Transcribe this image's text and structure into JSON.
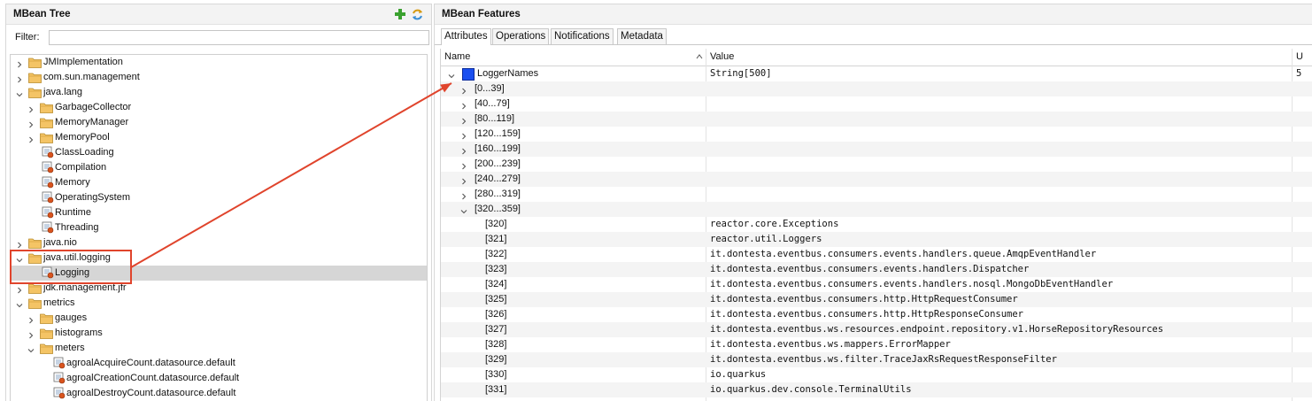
{
  "left_panel": {
    "title": "MBean Tree",
    "filter_label": "Filter:",
    "filter_value": "",
    "tree": [
      {
        "label": "JMImplementation",
        "level": 0,
        "type": "folder",
        "expanded": false
      },
      {
        "label": "com.sun.management",
        "level": 0,
        "type": "folder",
        "expanded": false
      },
      {
        "label": "java.lang",
        "level": 0,
        "type": "folder",
        "expanded": true
      },
      {
        "label": "GarbageCollector",
        "level": 1,
        "type": "folder",
        "expanded": false
      },
      {
        "label": "MemoryManager",
        "level": 1,
        "type": "folder",
        "expanded": false
      },
      {
        "label": "MemoryPool",
        "level": 1,
        "type": "folder",
        "expanded": false
      },
      {
        "label": "ClassLoading",
        "level": 1,
        "type": "bean"
      },
      {
        "label": "Compilation",
        "level": 1,
        "type": "bean"
      },
      {
        "label": "Memory",
        "level": 1,
        "type": "bean"
      },
      {
        "label": "OperatingSystem",
        "level": 1,
        "type": "bean"
      },
      {
        "label": "Runtime",
        "level": 1,
        "type": "bean"
      },
      {
        "label": "Threading",
        "level": 1,
        "type": "bean"
      },
      {
        "label": "java.nio",
        "level": 0,
        "type": "folder",
        "expanded": false
      },
      {
        "label": "java.util.logging",
        "level": 0,
        "type": "folder",
        "expanded": true
      },
      {
        "label": "Logging",
        "level": 1,
        "type": "bean",
        "selected": true
      },
      {
        "label": "jdk.management.jfr",
        "level": 0,
        "type": "folder",
        "expanded": false
      },
      {
        "label": "metrics",
        "level": 0,
        "type": "folder",
        "expanded": true
      },
      {
        "label": "gauges",
        "level": 1,
        "type": "folder",
        "expanded": false
      },
      {
        "label": "histograms",
        "level": 1,
        "type": "folder",
        "expanded": false
      },
      {
        "label": "meters",
        "level": 1,
        "type": "folder",
        "expanded": true
      },
      {
        "label": "agroalAcquireCount.datasource.default",
        "level": 2,
        "type": "bean"
      },
      {
        "label": "agroalCreationCount.datasource.default",
        "level": 2,
        "type": "bean"
      },
      {
        "label": "agroalDestroyCount.datasource.default",
        "level": 2,
        "type": "bean"
      }
    ]
  },
  "right_panel": {
    "title": "MBean Features",
    "tabs": [
      {
        "label": "Attributes",
        "active": true
      },
      {
        "label": "Operations",
        "active": false
      },
      {
        "label": "Notifications",
        "active": false
      },
      {
        "label": "Metadata",
        "active": false
      }
    ],
    "columns": {
      "name": "Name",
      "value": "Value",
      "third": "U"
    },
    "sort_indicator": "^",
    "rows": [
      {
        "name": "LoggerNames",
        "value": "String[500]",
        "third": "5",
        "level": 0,
        "chevron": "down",
        "square": true
      },
      {
        "name": "[0...39]",
        "value": "",
        "level": 1,
        "chevron": "right"
      },
      {
        "name": "[40...79]",
        "value": "",
        "level": 1,
        "chevron": "right"
      },
      {
        "name": "[80...119]",
        "value": "",
        "level": 1,
        "chevron": "right"
      },
      {
        "name": "[120...159]",
        "value": "",
        "level": 1,
        "chevron": "right"
      },
      {
        "name": "[160...199]",
        "value": "",
        "level": 1,
        "chevron": "right"
      },
      {
        "name": "[200...239]",
        "value": "",
        "level": 1,
        "chevron": "right"
      },
      {
        "name": "[240...279]",
        "value": "",
        "level": 1,
        "chevron": "right"
      },
      {
        "name": "[280...319]",
        "value": "",
        "level": 1,
        "chevron": "right"
      },
      {
        "name": "[320...359]",
        "value": "",
        "level": 1,
        "chevron": "down"
      },
      {
        "name": "[320]",
        "value": "reactor.core.Exceptions",
        "level": 2
      },
      {
        "name": "[321]",
        "value": "reactor.util.Loggers",
        "level": 2
      },
      {
        "name": "[322]",
        "value": "it.dontesta.eventbus.consumers.events.handlers.queue.AmqpEventHandler",
        "level": 2
      },
      {
        "name": "[323]",
        "value": "it.dontesta.eventbus.consumers.events.handlers.Dispatcher",
        "level": 2
      },
      {
        "name": "[324]",
        "value": "it.dontesta.eventbus.consumers.events.handlers.nosql.MongoDbEventHandler",
        "level": 2
      },
      {
        "name": "[325]",
        "value": "it.dontesta.eventbus.consumers.http.HttpRequestConsumer",
        "level": 2
      },
      {
        "name": "[326]",
        "value": "it.dontesta.eventbus.consumers.http.HttpResponseConsumer",
        "level": 2
      },
      {
        "name": "[327]",
        "value": "it.dontesta.eventbus.ws.resources.endpoint.repository.v1.HorseRepositoryResources",
        "level": 2
      },
      {
        "name": "[328]",
        "value": "it.dontesta.eventbus.ws.mappers.ErrorMapper",
        "level": 2
      },
      {
        "name": "[329]",
        "value": "it.dontesta.eventbus.ws.filter.TraceJaxRsRequestResponseFilter",
        "level": 2
      },
      {
        "name": "[330]",
        "value": "io.quarkus",
        "level": 2
      },
      {
        "name": "[331]",
        "value": "io.quarkus.dev.console.TerminalUtils",
        "level": 2
      }
    ]
  },
  "colors": {
    "highlight_box": "#e0442c",
    "arrow": "#e0442c",
    "square": "#1a4ff0",
    "selection": "#d6d6d6"
  },
  "icons": {
    "add": "green-plus-icon",
    "refresh": "refresh-icon",
    "folder": "folder-icon",
    "bean": "mbean-icon"
  }
}
